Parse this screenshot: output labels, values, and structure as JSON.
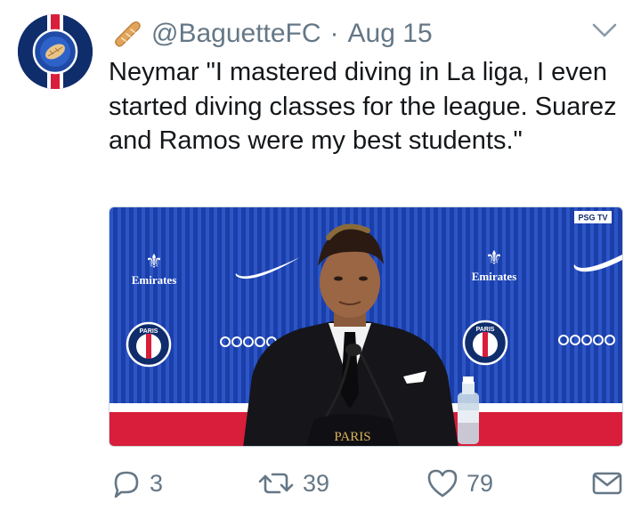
{
  "tweet": {
    "handle": "@BaguetteFC",
    "separator": "·",
    "date": "Aug 15",
    "text": "Neymar \"I mastered diving in La liga, I even started diving classes for the league. Suarez and Ramos were my best students.\"",
    "media": {
      "channel_badge": "PSG TV",
      "sponsor": "Emirates",
      "desk_label": "PARIS",
      "club_badge_text": "PARIS"
    },
    "stats": {
      "replies": "3",
      "retweets": "39",
      "likes": "79"
    }
  },
  "icons": {
    "author_emoji": "baguette-icon",
    "menu": "chevron-down-icon",
    "reply": "reply-icon",
    "retweet": "retweet-icon",
    "like": "heart-icon",
    "dm": "envelope-icon"
  },
  "colors": {
    "muted": "#657786",
    "psg_blue": "#0f2d6b",
    "psg_red": "#d81e3a"
  }
}
